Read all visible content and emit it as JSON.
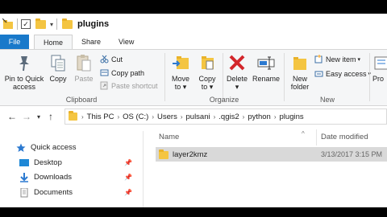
{
  "window": {
    "title": "plugins"
  },
  "tabs": {
    "file": "File",
    "home": "Home",
    "share": "Share",
    "view": "View"
  },
  "ribbon": {
    "clipboard": {
      "label": "Clipboard",
      "pin_line1": "Pin to Quick",
      "pin_line2": "access",
      "copy": "Copy",
      "paste": "Paste",
      "cut": "Cut",
      "copy_path": "Copy path",
      "paste_shortcut": "Paste shortcut"
    },
    "organize": {
      "label": "Organize",
      "move_to_line1": "Move",
      "move_to_line2": "to",
      "copy_to_line1": "Copy",
      "copy_to_line2": "to",
      "delete": "Delete",
      "rename": "Rename"
    },
    "new": {
      "label": "New",
      "new_folder_line1": "New",
      "new_folder_line2": "folder",
      "new_item": "New item",
      "easy_access": "Easy access"
    },
    "open": {
      "properties_partial": "Pro"
    }
  },
  "address": {
    "crumbs": [
      "This PC",
      "OS (C:)",
      "Users",
      "pulsani",
      ".qgis2",
      "python",
      "plugins"
    ]
  },
  "nav": {
    "items": [
      {
        "label": "Quick access"
      },
      {
        "label": "Desktop"
      },
      {
        "label": "Downloads"
      },
      {
        "label": "Documents"
      }
    ]
  },
  "content": {
    "columns": {
      "name": "Name",
      "date_modified": "Date modified"
    },
    "rows": [
      {
        "name": "layer2kmz",
        "date": "3/13/2017 3:15 PM"
      }
    ]
  },
  "colors": {
    "file_tab": "#1979ca",
    "folder": "#f4c542",
    "selected_row": "#d9d9d9",
    "delete_red": "#d3262b",
    "accent_blue": "#2b79d0"
  }
}
